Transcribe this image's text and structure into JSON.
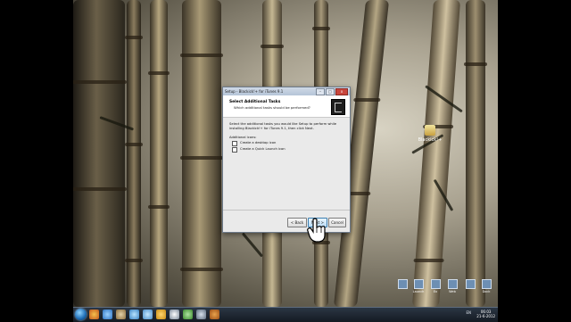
{
  "window": {
    "title": "Setup - Blackick!+ for iTunes 9.1",
    "minimize": "–",
    "maximize": "□",
    "close": "x"
  },
  "header": {
    "title": "Select Additional Tasks",
    "subtitle": "Which additional tasks should be performed?"
  },
  "body": {
    "description": "Select the additional tasks you would like Setup to perform while installing Blackick!+ for iTunes 9.1, then click Next.",
    "group_label": "Additional icons:",
    "options": [
      {
        "label": "Create a desktop icon",
        "checked": false
      },
      {
        "label": "Create a Quick Launch icon",
        "checked": false
      }
    ]
  },
  "buttons": {
    "back": "< Back",
    "next": "Next >",
    "cancel": "Cancel"
  },
  "desktop": {
    "icon_label": "Blackick!+"
  },
  "taskbar": {
    "shortcuts": [
      "Launch",
      "Ex",
      "Web",
      "Dock"
    ],
    "tray_lang": "EN",
    "clock_time": "06:03",
    "clock_date": "21-6-2012"
  }
}
